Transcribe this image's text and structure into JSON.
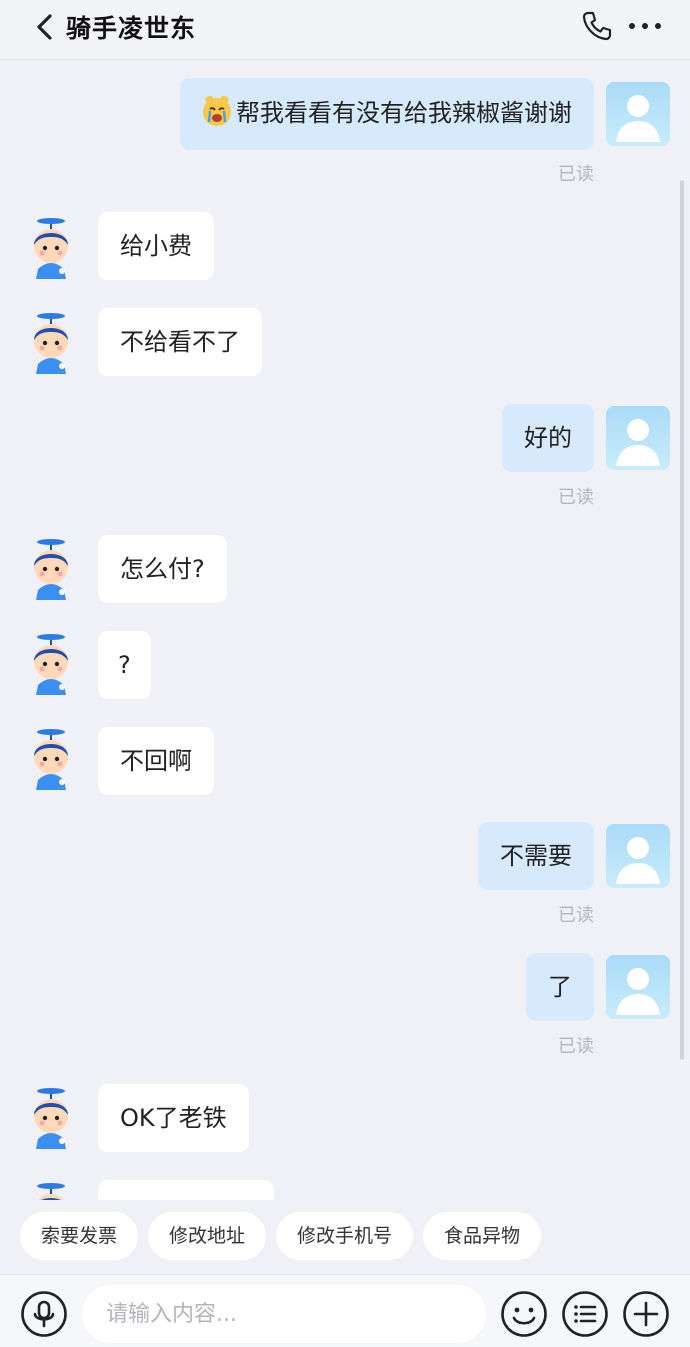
{
  "header": {
    "title": "骑手凌世东",
    "back_icon": "chevron-left-icon",
    "call_icon": "phone-icon",
    "more_icon": "more-dots-icon"
  },
  "messages": [
    {
      "from": "me",
      "text": "帮我看看有没有给我辣椒酱谢谢",
      "emoji": "crying-face-emoji",
      "status": "已读"
    },
    {
      "from": "rider",
      "text": "给小费"
    },
    {
      "from": "rider",
      "text": "不给看不了"
    },
    {
      "from": "me",
      "text": "好的",
      "status": "已读"
    },
    {
      "from": "rider",
      "text": "怎么付?"
    },
    {
      "from": "rider",
      "text": "?"
    },
    {
      "from": "rider",
      "text": "不回啊"
    },
    {
      "from": "me",
      "text": "不需要",
      "status": "已读"
    },
    {
      "from": "me",
      "text": "了",
      "status": "已读"
    },
    {
      "from": "rider",
      "text": "OK了老铁"
    }
  ],
  "quick_actions": [
    "索要发票",
    "修改地址",
    "修改手机号",
    "食品异物"
  ],
  "input": {
    "placeholder": "请输入内容...",
    "value": "",
    "voice_icon": "microphone-icon",
    "emoji_icon": "smiley-icon",
    "menu_icon": "list-menu-icon",
    "add_icon": "plus-icon"
  },
  "colors": {
    "background": "#eff1f6",
    "bubble_out": "#d7eafd",
    "bubble_in": "#ffffff",
    "read_status": "#b3b6bc",
    "rider_avatar": "#2c7be5"
  }
}
